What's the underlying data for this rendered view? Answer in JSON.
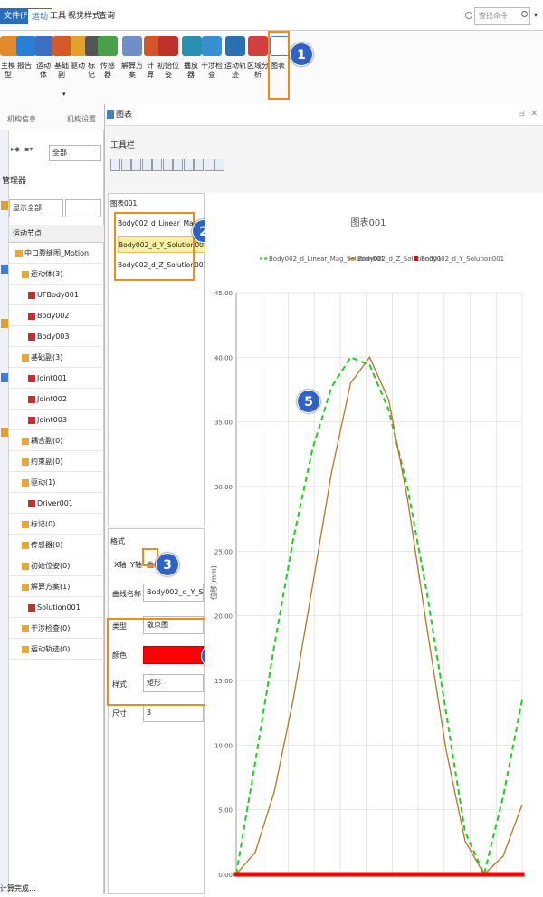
{
  "menu": {
    "file": "文件(F)",
    "items": [
      "运动",
      "工具",
      "视觉样式",
      "查询"
    ]
  },
  "search": {
    "placeholder": "查找命令"
  },
  "ribbon": {
    "buttons": [
      "主模型",
      "报告",
      "运动体",
      "基础副",
      "驱动",
      "标记",
      "传感器",
      "解算方案",
      "计算",
      "初始位姿",
      "播放器",
      "干涉检查",
      "运动轨迹",
      "区域分析",
      "图表"
    ],
    "groups": [
      "机构信息",
      "机构设置"
    ]
  },
  "left": {
    "filter_all": "全部",
    "manager": "管理器",
    "display_all": "显示全部",
    "tree_header": "运动节点",
    "nodes": [
      "中口裂缝图_Motion",
      "运动体(3)",
      "UFBody001",
      "Body002",
      "Body003",
      "基础副(3)",
      "Joint001",
      "Joint002",
      "Joint003",
      "耦合副(0)",
      "约束副(0)",
      "驱动(1)",
      "Driver001",
      "标记(0)",
      "传感器(0)",
      "初始位姿(0)",
      "解算方案(1)",
      "Solution001",
      "干涉检查(0)",
      "运动轨迹(0)"
    ],
    "status": "计算完成..."
  },
  "window": {
    "title": "图表",
    "toolbar_label": "工具栏"
  },
  "series_panel": {
    "root": "图表001",
    "items": [
      "Body002_d_Linear_Mag_Solution001",
      "Body002_d_Y_Solution001",
      "Body002_d_Z_Solution001"
    ]
  },
  "format": {
    "header": "格式",
    "tabs": [
      "X轴",
      "Y轴",
      "曲线"
    ],
    "curve_name_label": "曲线名称",
    "curve_name_value": "Body002_d_Y_Solution001",
    "type_label": "类型",
    "type_value": "散点图",
    "color_label": "颜色",
    "color_value": "#ff0000",
    "style_label": "样式",
    "style_value": "矩形",
    "size_label": "尺寸",
    "size_value": "3"
  },
  "callouts": [
    "1",
    "2",
    "3",
    "4",
    "5"
  ],
  "chart_data": {
    "type": "line",
    "title": "图表001",
    "ylabel": "位移(mm)",
    "xlabel": "",
    "ylim": [
      0,
      45
    ],
    "yticks": [
      "0.00",
      "5.00",
      "10.00",
      "15.00",
      "20.00",
      "25.00",
      "30.00",
      "35.00",
      "40.00",
      "45.00"
    ],
    "series": [
      {
        "name": "Body002_d_Linear_Mag_Solution001",
        "color": "#22cc22",
        "style": "dashed",
        "values": [
          0,
          8.7,
          17.7,
          26,
          32.9,
          37.7,
          40,
          39.4,
          35.9,
          29.8,
          21.8,
          12.6,
          3.3,
          0,
          6,
          13.5
        ]
      },
      {
        "name": "Body002_d_Z_Solution001",
        "color": "#b07828",
        "style": "solid",
        "values": [
          0,
          1.7,
          6.4,
          13.6,
          22.3,
          31.1,
          38,
          40,
          36.7,
          28.9,
          19.1,
          9.7,
          2.6,
          0,
          1.4,
          5.4
        ]
      },
      {
        "name": "Body002_d_Y_Solution001",
        "color": "#ff0000",
        "style": "markers",
        "values": [
          0,
          0,
          0,
          0,
          0,
          0,
          0,
          0,
          0,
          0,
          0,
          0,
          0,
          0,
          0,
          0
        ]
      }
    ]
  }
}
